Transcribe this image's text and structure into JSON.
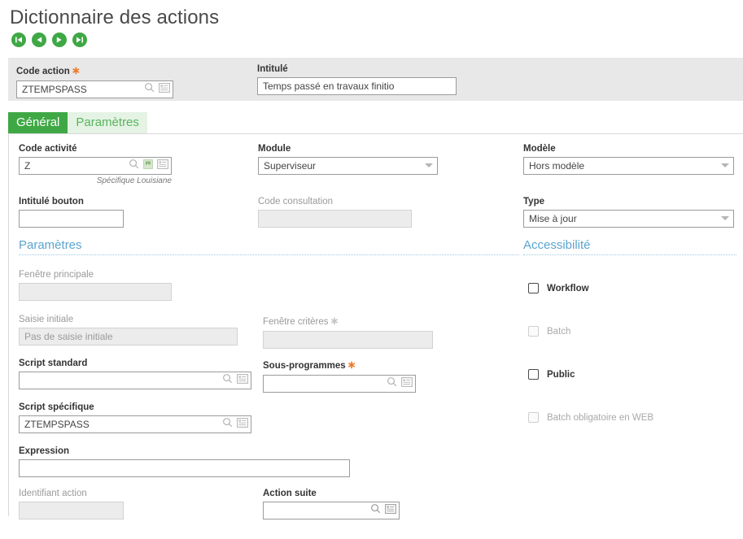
{
  "page": {
    "title": "Dictionnaire des actions"
  },
  "nav": {
    "first": "first-record",
    "previous": "previous-record",
    "next": "next-record",
    "last": "last-record"
  },
  "header": {
    "code_action": {
      "label": "Code action",
      "required": "∗",
      "value": "ZTEMPSPASS"
    },
    "intitule": {
      "label": "Intitulé",
      "value": "Temps passé en travaux finitio"
    }
  },
  "tabs": [
    {
      "label": "Général",
      "active": true
    },
    {
      "label": "Paramètres",
      "active": false
    }
  ],
  "general": {
    "code_activite": {
      "label": "Code activité",
      "value": "Z",
      "hint": "Spécifique Louisiane"
    },
    "intitule_bouton": {
      "label": "Intitulé bouton",
      "value": ""
    },
    "module": {
      "label": "Module",
      "value": "Superviseur"
    },
    "code_consultation": {
      "label": "Code consultation",
      "value": ""
    },
    "modele": {
      "label": "Modèle",
      "value": "Hors modèle"
    },
    "type": {
      "label": "Type",
      "value": "Mise à jour"
    }
  },
  "parametres": {
    "section_title": "Paramètres",
    "fenetre_principale": {
      "label": "Fenêtre principale",
      "value": ""
    },
    "saisie_initiale": {
      "label": "Saisie initiale",
      "value": "Pas de saisie initiale"
    },
    "fenetre_criteres": {
      "label": "Fenêtre critères",
      "required": "∗",
      "value": ""
    },
    "script_standard": {
      "label": "Script standard",
      "value": ""
    },
    "sous_programmes": {
      "label": "Sous-programmes",
      "required": "∗",
      "value": ""
    },
    "script_specifique": {
      "label": "Script spécifique",
      "value": "ZTEMPSPASS"
    },
    "expression": {
      "label": "Expression",
      "value": ""
    },
    "identifiant_action": {
      "label": "Identifiant action",
      "value": ""
    },
    "action_suite": {
      "label": "Action suite",
      "value": ""
    }
  },
  "accessibilite": {
    "section_title": "Accessibilité",
    "items": [
      {
        "label": "Workflow",
        "checked": false,
        "enabled": true
      },
      {
        "label": "Batch",
        "checked": false,
        "enabled": false
      },
      {
        "label": "Public",
        "checked": false,
        "enabled": true
      },
      {
        "label": "Batch obligatoire en WEB",
        "checked": false,
        "enabled": false
      }
    ]
  },
  "icons": {
    "search": "search-icon",
    "link": "link-icon",
    "list": "list-icon",
    "dropdown": "chevron-down-icon"
  },
  "colors": {
    "accent_green": "#3fa845",
    "tab_inactive_bg": "#e4f3e4",
    "section_blue": "#5ba4cf",
    "required_orange": "#ef7622",
    "band_grey": "#e8e8e8"
  }
}
